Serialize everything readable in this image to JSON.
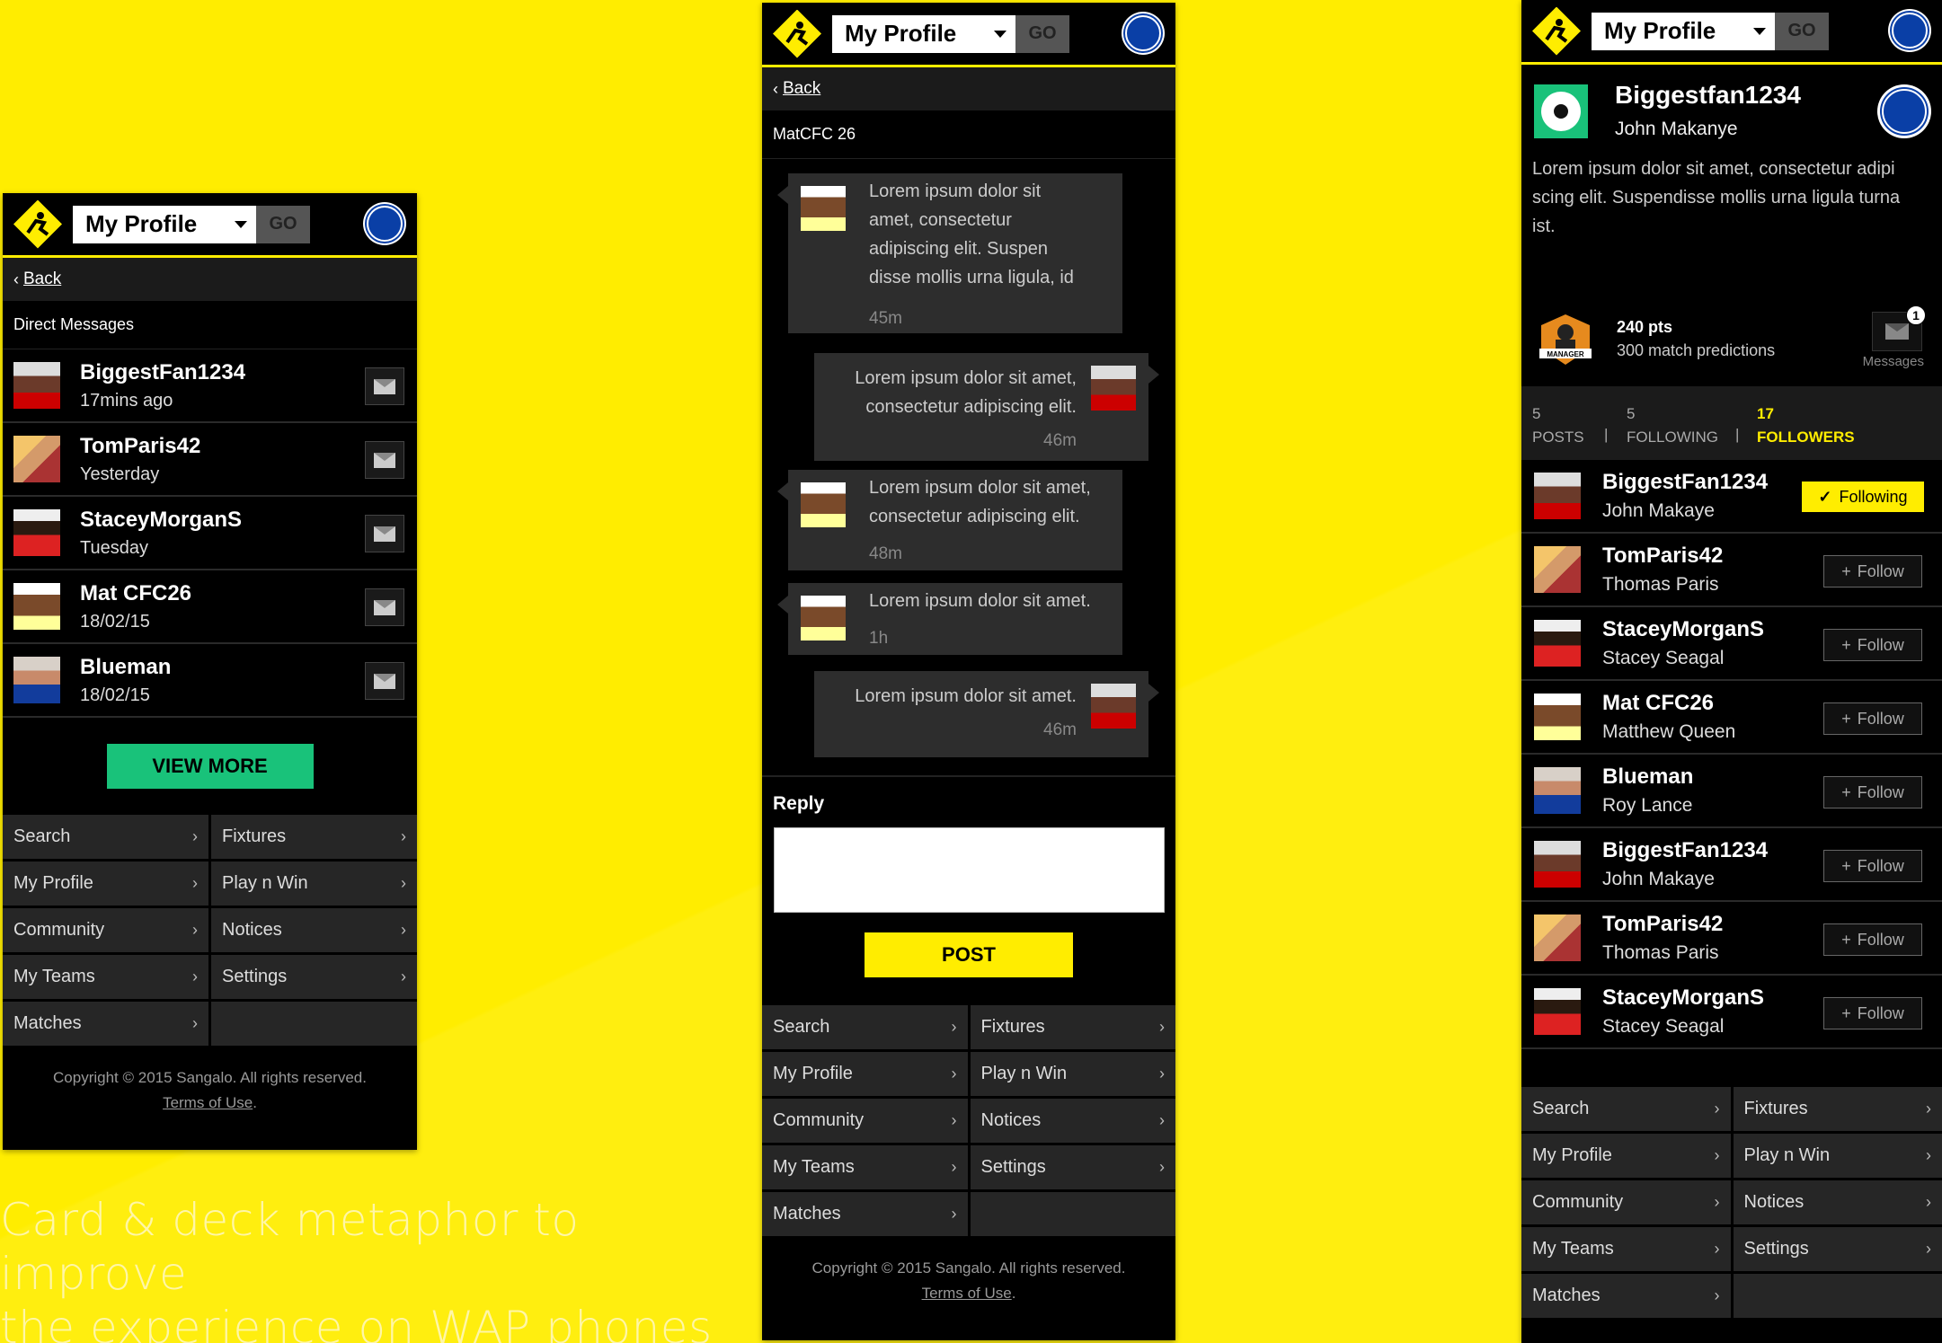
{
  "caption": {
    "line1": "Card & deck metaphor to improve",
    "line2": "the experience on WAP phones"
  },
  "colors": {
    "brand_yellow": "#FFED00",
    "accent_green": "#19C27A",
    "panel": "#262626"
  },
  "header": {
    "select_value": "My Profile",
    "go_label": "GO"
  },
  "back_label": "Back",
  "menu": [
    {
      "label": "Search"
    },
    {
      "label": "Fixtures"
    },
    {
      "label": "My Profile"
    },
    {
      "label": "Play n Win"
    },
    {
      "label": "Community"
    },
    {
      "label": "Notices"
    },
    {
      "label": "My Teams"
    },
    {
      "label": "Settings"
    },
    {
      "label": "Matches"
    }
  ],
  "footer": {
    "copyright": "Copyright © 2015 Sangalo. All rights reserved.",
    "terms": "Terms of Use",
    "period": "."
  },
  "dm_screen": {
    "title": "Direct Messages",
    "rows": [
      {
        "name": "BiggestFan1234",
        "sub": "17mins ago"
      },
      {
        "name": "TomParis42",
        "sub": "Yesterday"
      },
      {
        "name": "StaceyMorganS",
        "sub": "Tuesday"
      },
      {
        "name": "Mat CFC26",
        "sub": "18/02/15"
      },
      {
        "name": "Blueman",
        "sub": "18/02/15"
      }
    ],
    "view_more": "VIEW MORE"
  },
  "chat_screen": {
    "title": "MatCFC 26",
    "messages": [
      {
        "side": "left",
        "lines": [
          "Lorem ipsum dolor sit",
          "amet, consectetur",
          "adipiscing elit. Suspen",
          "disse mollis urna ligula, id"
        ],
        "time": "45m"
      },
      {
        "side": "right",
        "lines": [
          "Lorem ipsum dolor sit amet,",
          "consectetur adipiscing elit."
        ],
        "time": "46m"
      },
      {
        "side": "left",
        "lines": [
          "Lorem ipsum dolor sit amet,",
          "consectetur adipiscing elit."
        ],
        "time": "48m"
      },
      {
        "side": "left",
        "lines": [
          "Lorem ipsum dolor sit amet."
        ],
        "time": "1h"
      },
      {
        "side": "right",
        "lines": [
          "Lorem ipsum dolor sit amet."
        ],
        "time": "46m"
      }
    ],
    "reply_label": "Reply",
    "post_label": "POST"
  },
  "profile_screen": {
    "username": "Biggestfan1234",
    "real_name": "John Makanye",
    "bio": "Lorem ipsum dolor sit amet, consectetur adipi scing elit. Suspendisse mollis urna ligula turna ist.",
    "badge_label": "MANAGER",
    "points": "240 pts",
    "predictions": "300 match predictions",
    "messages_label": "Messages",
    "messages_count": "1",
    "stats": {
      "posts_count": "5",
      "posts_label": "POSTS",
      "following_count": "5",
      "following_label": "FOLLOWING",
      "followers_count": "17",
      "followers_label": "FOLLOWERS",
      "separator": "|"
    },
    "followers": [
      {
        "name": "BiggestFan1234",
        "real": "John Makaye",
        "button": "Following",
        "following": true
      },
      {
        "name": "TomParis42",
        "real": "Thomas Paris",
        "button": "Follow",
        "following": false
      },
      {
        "name": "StaceyMorganS",
        "real": "Stacey Seagal",
        "button": "Follow",
        "following": false
      },
      {
        "name": "Mat CFC26",
        "real": "Matthew Queen",
        "button": "Follow",
        "following": false
      },
      {
        "name": "Blueman",
        "real": "Roy Lance",
        "button": "Follow",
        "following": false
      },
      {
        "name": "BiggestFan1234",
        "real": "John Makaye",
        "button": "Follow",
        "following": false
      },
      {
        "name": "TomParis42",
        "real": "Thomas Paris",
        "button": "Follow",
        "following": false
      },
      {
        "name": "StaceyMorganS",
        "real": "Stacey Seagal",
        "button": "Follow",
        "following": false
      }
    ]
  }
}
